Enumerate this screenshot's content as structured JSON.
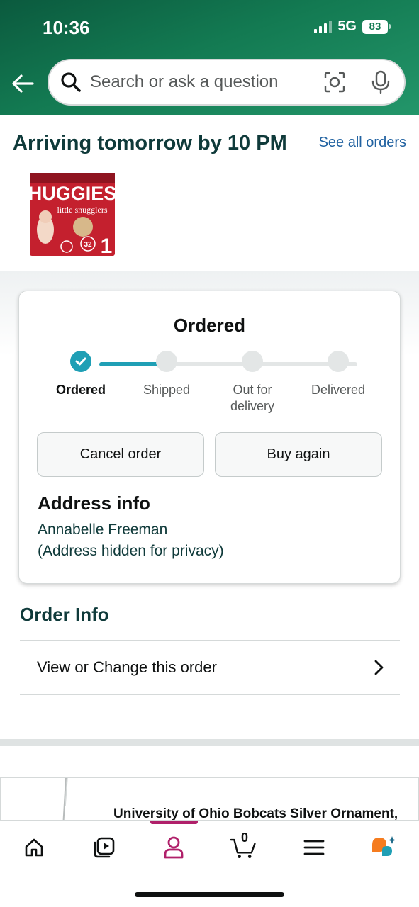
{
  "status_bar": {
    "time": "10:36",
    "network": "5G",
    "battery": "83"
  },
  "search": {
    "placeholder": "Search or ask a question"
  },
  "arriving": {
    "title": "Arriving tomorrow by 10 PM",
    "see_all": "See all orders"
  },
  "product": {
    "brand": "HUGGIES",
    "line": "little snugglers",
    "count": "32",
    "size": "1"
  },
  "status_card": {
    "title": "Ordered",
    "progress_step": 1,
    "steps": [
      {
        "label": "Ordered"
      },
      {
        "label": "Shipped"
      },
      {
        "label": "Out for delivery"
      },
      {
        "label": "Delivered"
      }
    ],
    "cancel_label": "Cancel order",
    "buy_again_label": "Buy again",
    "address_heading": "Address info",
    "address_name": "Annabelle Freeman",
    "address_note": "(Address hidden for privacy)"
  },
  "order_info": {
    "heading": "Order Info",
    "view_change": "View or Change this order"
  },
  "recommendation": {
    "title": "University of Ohio Bobcats Silver Ornament,"
  },
  "bottom_nav": {
    "cart_count": "0",
    "active_tab": "account"
  },
  "colors": {
    "accent_teal": "#1f9fb5",
    "header_green": "#137a52",
    "link_blue": "#2162a1",
    "nav_active": "#b0206a"
  }
}
